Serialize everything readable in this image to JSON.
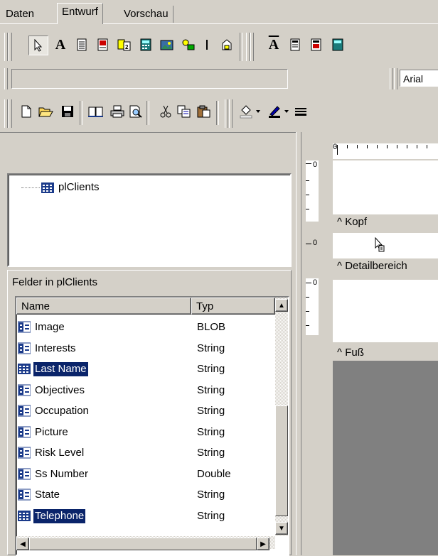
{
  "tabs": [
    {
      "label": "Daten"
    },
    {
      "label": "Entwurf"
    },
    {
      "label": "Vorschau"
    }
  ],
  "format_toolbar": {
    "font_name": "Arial"
  },
  "tree": {
    "root_label": "plClients"
  },
  "fields_panel": {
    "title": "Felder in plClients",
    "columns": {
      "name": "Name",
      "type": "Typ"
    },
    "items": [
      {
        "name": "Image",
        "type": "BLOB",
        "selected": false
      },
      {
        "name": "Interests",
        "type": "String",
        "selected": false
      },
      {
        "name": "Last Name",
        "type": "String",
        "selected": true
      },
      {
        "name": "Objectives",
        "type": "String",
        "selected": false
      },
      {
        "name": "Occupation",
        "type": "String",
        "selected": false
      },
      {
        "name": "Picture",
        "type": "String",
        "selected": false
      },
      {
        "name": "Risk Level",
        "type": "String",
        "selected": false
      },
      {
        "name": "Ss Number",
        "type": "Double",
        "selected": false
      },
      {
        "name": "State",
        "type": "String",
        "selected": false
      },
      {
        "name": "Telephone",
        "type": "String",
        "selected": true
      }
    ]
  },
  "report_designer": {
    "ruler_zero": "0",
    "bands": [
      {
        "label": "^ Kopf",
        "vruler": "0"
      },
      {
        "label": "^ Detailbereich",
        "vruler": "0"
      },
      {
        "label": "^ Fuß",
        "vruler": "0"
      }
    ]
  },
  "colors": {
    "face": "#d4d0c8",
    "selection": "#0a246a",
    "workspace": "#808080"
  }
}
